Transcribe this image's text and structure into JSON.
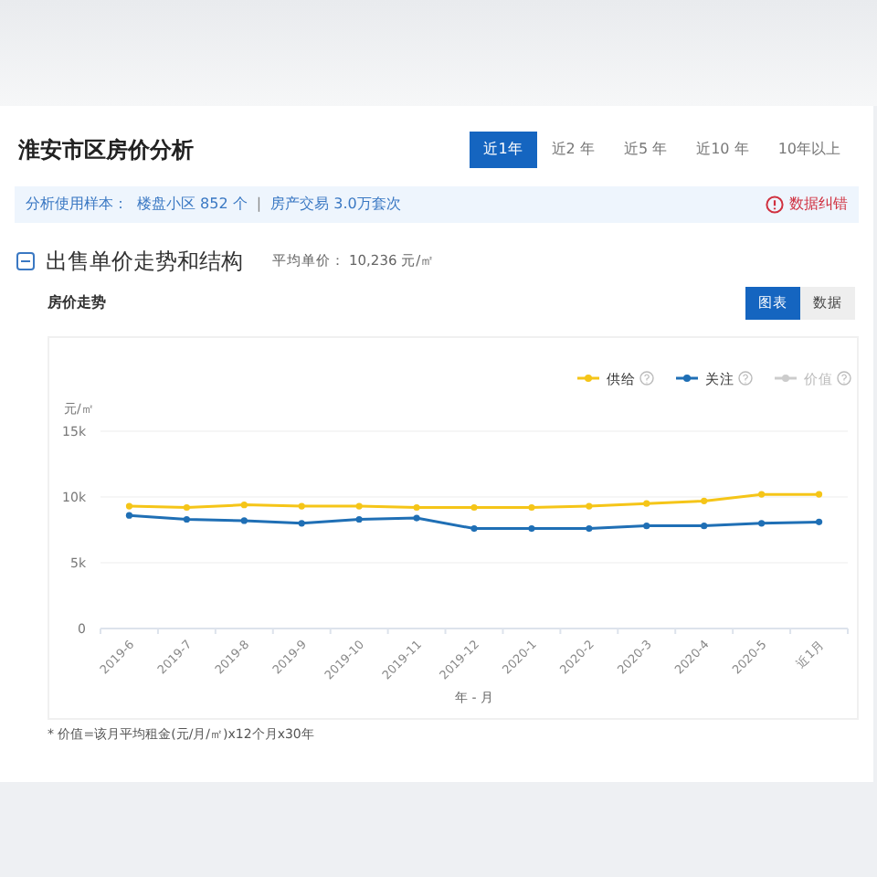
{
  "title": "淮安市区房价分析",
  "ranges": [
    {
      "label": "近1年",
      "selected": true
    },
    {
      "label": "近2 年",
      "selected": false
    },
    {
      "label": "近5 年",
      "selected": false
    },
    {
      "label": "近10 年",
      "selected": false
    },
    {
      "label": "10年以上",
      "selected": false
    }
  ],
  "info_bar": {
    "sample_label": "分析使用样本：",
    "sample_communities": "楼盘小区 852 个",
    "separator": "|",
    "sample_trades": "房产交易 3.0万套次",
    "report": "数据纠错"
  },
  "section": {
    "title": "出售单价走势和结构",
    "expanded": true,
    "average_label": "平均单价：",
    "average_value": "10,236 元/㎡"
  },
  "trend": {
    "title": "房价走势",
    "views": [
      {
        "label": "图表",
        "selected": true
      },
      {
        "label": "数据",
        "selected": false
      }
    ],
    "chart_data": {
      "type": "line",
      "xlabel": "年 - 月",
      "ylabel": "元/㎡",
      "legend": true,
      "categories": [
        "2019-6",
        "2019-7",
        "2019-8",
        "2019-9",
        "2019-10",
        "2019-11",
        "2019-12",
        "2020-1",
        "2020-2",
        "2020-3",
        "2020-4",
        "2020-5",
        "近1月"
      ],
      "ylim": [
        0,
        15000
      ],
      "yticks": [
        {
          "value": 0,
          "label": "0"
        },
        {
          "value": 5000,
          "label": "5k"
        },
        {
          "value": 10000,
          "label": "10k"
        },
        {
          "value": 15000,
          "label": "15k"
        }
      ],
      "series": [
        {
          "name": "供给",
          "color": "#f5c518",
          "marker": "circle",
          "values": [
            9300,
            9200,
            9400,
            9300,
            9300,
            9200,
            9200,
            9200,
            9300,
            9500,
            9700,
            10200,
            10200
          ]
        },
        {
          "name": "关注",
          "color": "#1f6fb5",
          "marker": "circle",
          "values": [
            8600,
            8300,
            8200,
            8000,
            8300,
            8400,
            7600,
            7600,
            7600,
            7800,
            7800,
            8000,
            8100
          ]
        },
        {
          "name": "价值",
          "color": "#cccccc",
          "marker": "circle",
          "values": [
            null,
            null,
            null,
            null,
            null,
            null,
            null,
            null,
            null,
            null,
            null,
            null,
            null
          ]
        }
      ]
    },
    "footnote": "* 价值=该月平均租金(元/月/㎡)x12个月x30年"
  }
}
